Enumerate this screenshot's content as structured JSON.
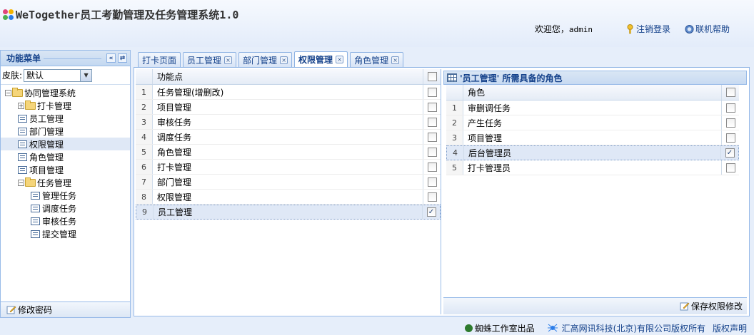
{
  "header": {
    "title": "WeTogether员工考勤管理及任务管理系统1.0",
    "welcome_prefix": "欢迎您，",
    "username": "admin",
    "logout_label": "注销登录",
    "help_label": "联机帮助"
  },
  "sidebar": {
    "title": "功能菜单",
    "skin_label": "皮肤:",
    "skin_value": "默认",
    "tree": [
      {
        "label": "协同管理系统",
        "level": 0,
        "type": "folder",
        "expander": "−"
      },
      {
        "label": "打卡管理",
        "level": 1,
        "type": "folder",
        "expander": "+"
      },
      {
        "label": "员工管理",
        "level": 1,
        "type": "leaf"
      },
      {
        "label": "部门管理",
        "level": 1,
        "type": "leaf"
      },
      {
        "label": "权限管理",
        "level": 1,
        "type": "leaf",
        "selected": true
      },
      {
        "label": "角色管理",
        "level": 1,
        "type": "leaf"
      },
      {
        "label": "项目管理",
        "level": 1,
        "type": "leaf"
      },
      {
        "label": "任务管理",
        "level": 1,
        "type": "folder",
        "expander": "−"
      },
      {
        "label": "管理任务",
        "level": 2,
        "type": "leaf"
      },
      {
        "label": "调度任务",
        "level": 2,
        "type": "leaf"
      },
      {
        "label": "审核任务",
        "level": 2,
        "type": "leaf"
      },
      {
        "label": "提交管理",
        "level": 2,
        "type": "leaf"
      }
    ],
    "footer_label": "修改密码"
  },
  "tabs": [
    {
      "label": "打卡页面",
      "closable": false,
      "active": false
    },
    {
      "label": "员工管理",
      "closable": true,
      "active": false
    },
    {
      "label": "部门管理",
      "closable": true,
      "active": false
    },
    {
      "label": "权限管理",
      "closable": true,
      "active": true
    },
    {
      "label": "角色管理",
      "closable": true,
      "active": false
    }
  ],
  "function_grid": {
    "header": "功能点",
    "rows": [
      {
        "num": "1",
        "name": "任务管理(增删改)",
        "checked": false
      },
      {
        "num": "2",
        "name": "项目管理",
        "checked": false
      },
      {
        "num": "3",
        "name": "审核任务",
        "checked": false
      },
      {
        "num": "4",
        "name": "调度任务",
        "checked": false
      },
      {
        "num": "5",
        "name": "角色管理",
        "checked": false
      },
      {
        "num": "6",
        "name": "打卡管理",
        "checked": false
      },
      {
        "num": "7",
        "name": "部门管理",
        "checked": false
      },
      {
        "num": "8",
        "name": "权限管理",
        "checked": false
      },
      {
        "num": "9",
        "name": "员工管理",
        "checked": true,
        "selected": true
      }
    ]
  },
  "role_panel": {
    "title": "'员工管理' 所需具备的角色",
    "header": "角色",
    "rows": [
      {
        "num": "1",
        "name": "审删调任务",
        "checked": false
      },
      {
        "num": "2",
        "name": "产生任务",
        "checked": false
      },
      {
        "num": "3",
        "name": "项目管理",
        "checked": false
      },
      {
        "num": "4",
        "name": "后台管理员",
        "checked": true,
        "selected": true
      },
      {
        "num": "5",
        "name": "打卡管理员",
        "checked": false
      }
    ],
    "save_label": "保存权限修改"
  },
  "footer": {
    "studio": "蜘蛛工作室出品",
    "company": "汇高网讯科技(北京)有限公司版权所有",
    "copyright_link": "版权声明"
  }
}
